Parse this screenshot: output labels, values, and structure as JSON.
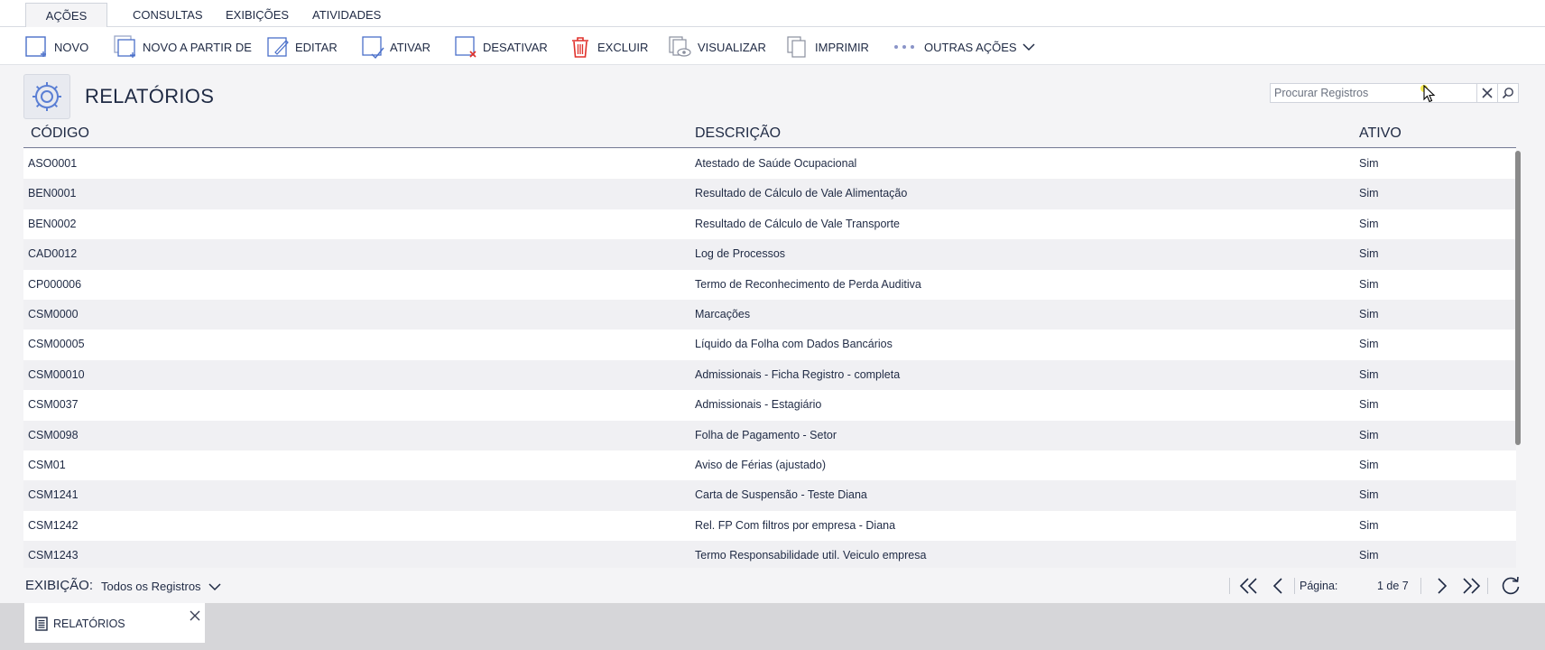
{
  "tabs": [
    {
      "label": "AÇÕES",
      "active": true
    },
    {
      "label": "CONSULTAS",
      "active": false
    },
    {
      "label": "EXIBIÇÕES",
      "active": false
    },
    {
      "label": "ATIVIDADES",
      "active": false
    }
  ],
  "toolbar": {
    "novo": "NOVO",
    "novo_a_partir": "NOVO A PARTIR DE",
    "editar": "EDITAR",
    "ativar": "ATIVAR",
    "desativar": "DESATIVAR",
    "excluir": "EXCLUIR",
    "visualizar": "VISUALIZAR",
    "imprimir": "IMPRIMIR",
    "outras_acoes": "OUTRAS AÇÕES"
  },
  "header": {
    "title": "RELATÓRIOS",
    "search_placeholder": "Procurar Registros"
  },
  "table": {
    "columns": [
      "CÓDIGO",
      "DESCRIÇÃO",
      "ATIVO"
    ],
    "rows": [
      {
        "codigo": "ASO0001",
        "descricao": "Atestado de Saúde Ocupacional",
        "ativo": "Sim"
      },
      {
        "codigo": "BEN0001",
        "descricao": "Resultado de Cálculo de Vale Alimentação",
        "ativo": "Sim"
      },
      {
        "codigo": "BEN0002",
        "descricao": "Resultado de Cálculo de Vale Transporte",
        "ativo": "Sim"
      },
      {
        "codigo": "CAD0012",
        "descricao": "Log de Processos",
        "ativo": "Sim"
      },
      {
        "codigo": "CP000006",
        "descricao": "Termo de Reconhecimento de Perda Auditiva",
        "ativo": "Sim"
      },
      {
        "codigo": "CSM0000",
        "descricao": "Marcações",
        "ativo": "Sim"
      },
      {
        "codigo": "CSM00005",
        "descricao": "Líquido da Folha com Dados Bancários",
        "ativo": "Sim"
      },
      {
        "codigo": "CSM00010",
        "descricao": "Admissionais - Ficha Registro - completa",
        "ativo": "Sim"
      },
      {
        "codigo": "CSM0037",
        "descricao": "Admissionais - Estagiário",
        "ativo": "Sim"
      },
      {
        "codigo": "CSM0098",
        "descricao": "Folha de Pagamento - Setor",
        "ativo": "Sim"
      },
      {
        "codigo": "CSM01",
        "descricao": "Aviso de Férias (ajustado)",
        "ativo": "Sim"
      },
      {
        "codigo": "CSM1241",
        "descricao": "Carta de Suspensão - Teste Diana",
        "ativo": "Sim"
      },
      {
        "codigo": "CSM1242",
        "descricao": "Rel. FP Com filtros por empresa - Diana",
        "ativo": "Sim"
      },
      {
        "codigo": "CSM1243",
        "descricao": "Termo Responsabilidade util. Veiculo empresa",
        "ativo": "Sim"
      }
    ]
  },
  "footer": {
    "exibicao_label": "EXIBIÇÃO:",
    "exibicao_value": "Todos os Registros",
    "pagina_label": "Página:",
    "pagina_value": "1 de 7"
  },
  "dock": {
    "tab_label": "RELATÓRIOS"
  },
  "colors": {
    "accent": "#4a6fc9",
    "danger": "#e0312b",
    "text": "#1f2a44"
  }
}
